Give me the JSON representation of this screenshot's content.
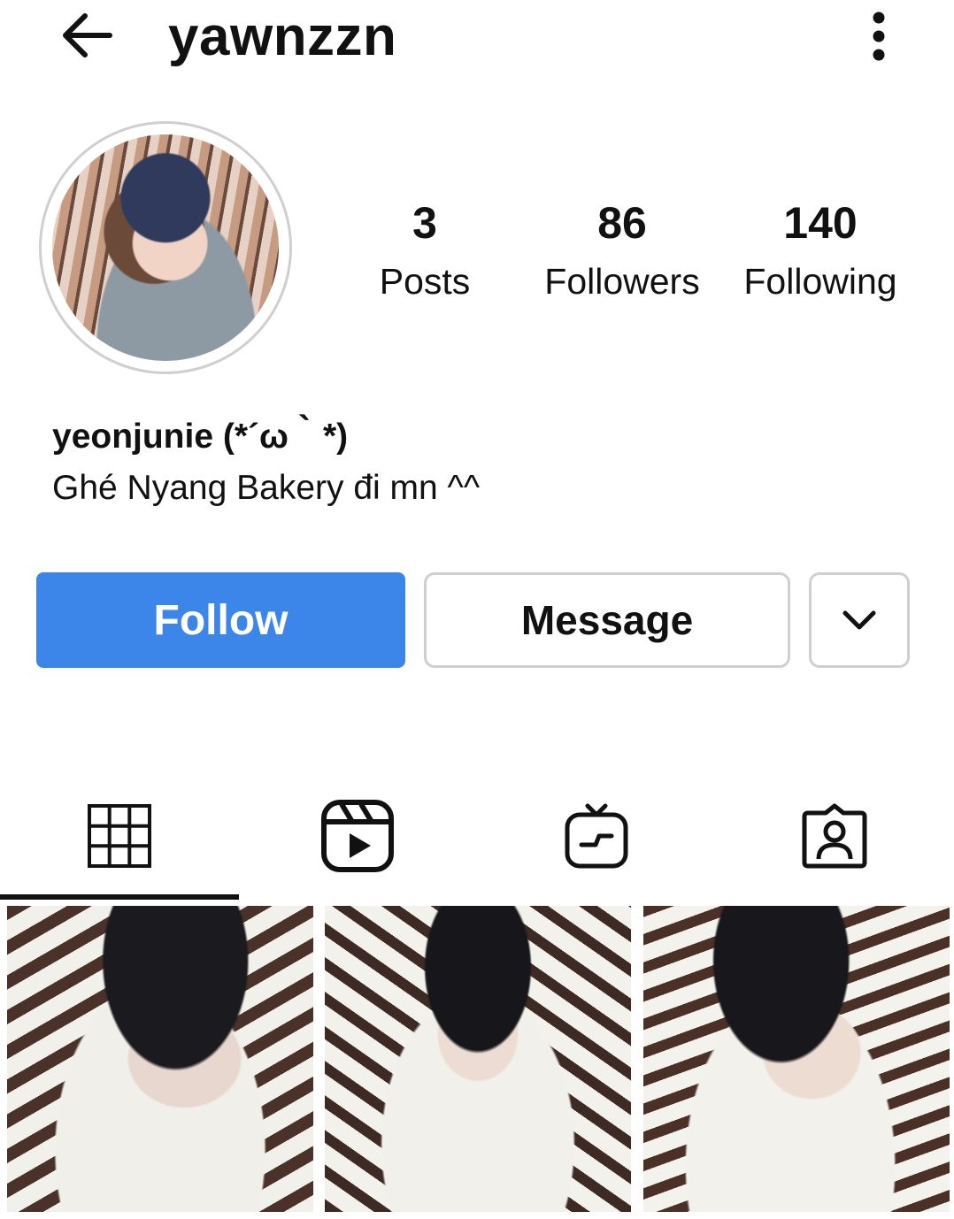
{
  "header": {
    "username": "yawnzzn",
    "back_icon": "arrow-left-icon",
    "more_icon": "vertical-ellipsis-icon"
  },
  "profile": {
    "avatar_icon": "profile-photo",
    "stats": {
      "posts": {
        "value": "3",
        "label": "Posts"
      },
      "followers": {
        "value": "86",
        "label": "Followers"
      },
      "following": {
        "value": "140",
        "label": "Following"
      }
    },
    "display_name": "yeonjunie (*´ω｀*)",
    "bio": "Ghé Nyang Bakery đi mn ^^"
  },
  "actions": {
    "follow_label": "Follow",
    "message_label": "Message",
    "suggest_icon": "chevron-down-icon",
    "accent_color": "#3b86e8"
  },
  "tabs": [
    {
      "name": "grid",
      "icon": "grid-icon",
      "active": true
    },
    {
      "name": "reels",
      "icon": "reels-icon",
      "active": false
    },
    {
      "name": "igtv",
      "icon": "igtv-icon",
      "active": false
    },
    {
      "name": "tagged",
      "icon": "tagged-icon",
      "active": false
    }
  ],
  "posts_count_visible": 3
}
